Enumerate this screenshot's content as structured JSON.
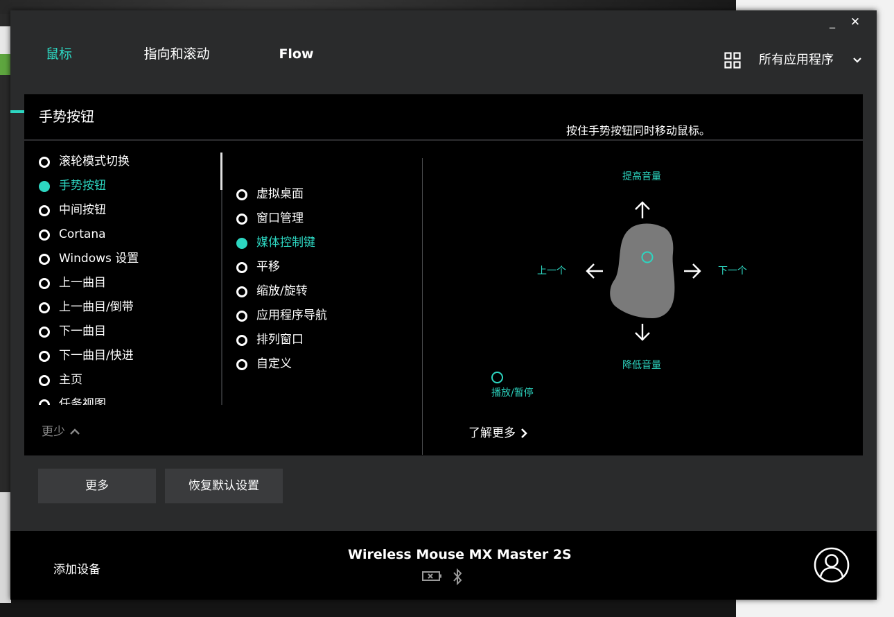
{
  "window": {
    "minimize": "_",
    "close": "✕"
  },
  "tabs": [
    {
      "label": "鼠标",
      "active": true
    },
    {
      "label": "指向和滚动",
      "active": false
    },
    {
      "label": "Flow",
      "active": false
    }
  ],
  "app_selector": {
    "icon": "grid-icon",
    "label": "所有应用程序"
  },
  "panel": {
    "title": "手势按钮",
    "description": "按住手势按钮同时移动鼠标。"
  },
  "button_actions": [
    {
      "label": "滚轮模式切换",
      "selected": false
    },
    {
      "label": "手势按钮",
      "selected": true
    },
    {
      "label": "中间按钮",
      "selected": false
    },
    {
      "label": "Cortana",
      "selected": false
    },
    {
      "label": "Windows 设置",
      "selected": false
    },
    {
      "label": "上一曲目",
      "selected": false
    },
    {
      "label": "上一曲目/倒带",
      "selected": false
    },
    {
      "label": "下一曲目",
      "selected": false
    },
    {
      "label": "下一曲目/快进",
      "selected": false
    },
    {
      "label": "主页",
      "selected": false
    },
    {
      "label": "任务视图",
      "selected": false
    }
  ],
  "less_label": "更少",
  "gesture_presets": [
    {
      "label": "虚拟桌面",
      "selected": false
    },
    {
      "label": "窗口管理",
      "selected": false
    },
    {
      "label": "媒体控制键",
      "selected": true
    },
    {
      "label": "平移",
      "selected": false
    },
    {
      "label": "缩放/旋转",
      "selected": false
    },
    {
      "label": "应用程序导航",
      "selected": false
    },
    {
      "label": "排列窗口",
      "selected": false
    },
    {
      "label": "自定义",
      "selected": false
    }
  ],
  "gesture_map": {
    "up": "提高音量",
    "down": "降低音量",
    "left": "上一个",
    "right": "下一个",
    "click": "播放/暂停"
  },
  "learn_more": "了解更多",
  "buttons": {
    "more": "更多",
    "reset": "恢复默认设置"
  },
  "footer": {
    "add_device": "添加设备",
    "device_name": "Wireless Mouse MX Master 2S"
  },
  "colors": {
    "accent": "#2dd6c1",
    "panel_bg": "#000000",
    "window_bg": "#2a2b2c"
  }
}
